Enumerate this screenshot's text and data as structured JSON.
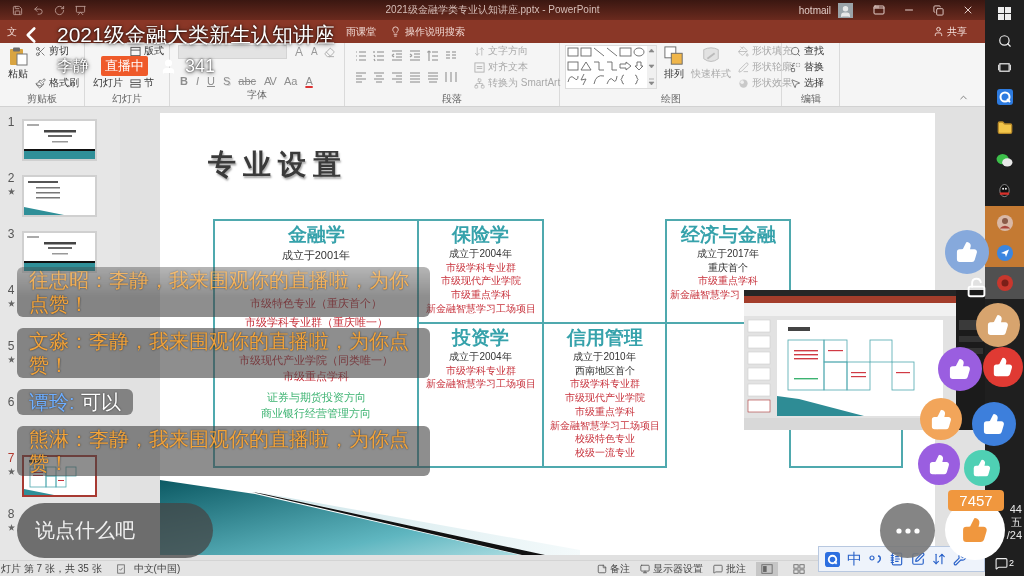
{
  "stream": {
    "title": "2021级金融大类新生认知讲座",
    "host": "李静",
    "status": "直播中",
    "viewers": "341",
    "chat": [
      {
        "kind": "like",
        "user": "往忠昭：",
        "text": "李静，我来围观你的直播啦，为你点赞！"
      },
      {
        "kind": "like",
        "user": "文淼：",
        "text": "李静，我来围观你的直播啦，为你点赞！"
      },
      {
        "kind": "chat",
        "user": "谭玲:",
        "text": "可以"
      },
      {
        "kind": "like",
        "user": "熊淋：",
        "text": "李静，我来围观你的直播啦，为你点赞！"
      }
    ],
    "input": {
      "placeholder": "说点什么吧"
    },
    "like_count": "7457",
    "floating_likes": [
      {
        "color": "#86a9dc"
      },
      {
        "color": "#d7a46e"
      },
      {
        "color": "#9a5ee0"
      },
      {
        "color": "#e03a33"
      },
      {
        "color": "#f2a55a"
      },
      {
        "color": "#3d7fdc"
      },
      {
        "color": "#9a5ee0"
      },
      {
        "color": "#4fd0b4"
      }
    ]
  },
  "powerpoint": {
    "window_title": "2021级金融学类专业认知讲座.pptx - PowerPoint",
    "account": "hotmail",
    "tabs": [
      {
        "label": "文",
        "selected": false
      },
      {
        "label": "雨课堂",
        "selected": false
      }
    ],
    "search": "操作说明搜索",
    "share": "共享",
    "ribbon": [
      {
        "kind": "clipboard",
        "label": "剪贴板",
        "big": [
          {
            "label": "粘贴",
            "disabled": false
          }
        ],
        "small": [
          {
            "label": "剪切",
            "disabled": false
          },
          {
            "label": "格式刷",
            "disabled": false
          }
        ]
      },
      {
        "kind": "slides",
        "label": "幻灯片",
        "big": [
          {
            "label": "幻灯片",
            "disabled": false
          }
        ],
        "small": [
          {
            "label": "版式",
            "disabled": false
          },
          {
            "label": "节",
            "disabled": false
          }
        ]
      },
      {
        "kind": "font",
        "label": "字体",
        "size_buttons": [
          "A",
          "A"
        ],
        "buttons": [
          "B",
          "I",
          "U",
          "S",
          "abc",
          "AV",
          "Aa",
          "A"
        ]
      },
      {
        "kind": "paragraph",
        "label": "段落",
        "small": [
          {
            "label": "文字方向",
            "disabled": true
          },
          {
            "label": "对齐文本",
            "disabled": true
          },
          {
            "label": "转换为 SmartArt",
            "disabled": true
          }
        ]
      },
      {
        "kind": "drawing",
        "label": "绘图",
        "big": [
          {
            "label": "排列",
            "disabled": false
          },
          {
            "label": "快速样式",
            "disabled": true
          }
        ],
        "small": [
          {
            "label": "形状填充",
            "disabled": true
          },
          {
            "label": "形状轮廓",
            "disabled": true
          },
          {
            "label": "形状效果",
            "disabled": true
          }
        ]
      },
      {
        "kind": "editing",
        "label": "编辑",
        "small": [
          {
            "label": "查找",
            "disabled": false
          },
          {
            "label": "替换",
            "disabled": false
          },
          {
            "label": "选择",
            "disabled": false
          }
        ]
      }
    ],
    "slides": [
      {
        "number": "1",
        "animated": false,
        "selected": false,
        "preview": {
          "kind": "title"
        }
      },
      {
        "number": "2",
        "animated": true,
        "selected": false,
        "preview": {
          "kind": "list"
        }
      },
      {
        "number": "3",
        "animated": false,
        "selected": false,
        "preview": {
          "kind": "title"
        }
      },
      {
        "number": "4",
        "animated": true,
        "selected": false
      },
      {
        "number": "5",
        "animated": true,
        "selected": false
      },
      {
        "number": "6",
        "animated": false,
        "selected": false
      },
      {
        "number": "7",
        "animated": true,
        "selected": true,
        "preview": {
          "kind": "table"
        }
      },
      {
        "number": "8",
        "animated": true,
        "selected": false
      }
    ],
    "slide": {
      "title": "专业设置",
      "boxes": [
        {
          "title": "金融学",
          "lines": [
            {
              "kind": "fact",
              "text": "成立于2001年"
            },
            {
              "kind": "honor",
              "text": "市级特色专业（重庆首个）"
            },
            {
              "kind": "honor",
              "text": "市级学科专业群（重庆唯一）"
            },
            {
              "kind": "honor",
              "text": "市级现代产业学院（同类唯一）"
            },
            {
              "kind": "honor",
              "text": "市级重点学科"
            },
            {
              "kind": "track",
              "text": "证券与期货投资方向"
            },
            {
              "kind": "track",
              "text": "商业银行经营管理方向"
            }
          ]
        },
        {
          "title": "保险学",
          "lines": [
            {
              "kind": "fact",
              "text": "成立于2004年"
            },
            {
              "kind": "honor",
              "text": "市级学科专业群"
            },
            {
              "kind": "honor",
              "text": "市级现代产业学院"
            },
            {
              "kind": "honor",
              "text": "市级重点学科"
            },
            {
              "kind": "honor",
              "text": "新金融智慧学习工场项目"
            }
          ]
        },
        {
          "title": "投资学",
          "lines": [
            {
              "kind": "fact",
              "text": "成立于2004年"
            },
            {
              "kind": "honor",
              "text": "市级学科专业群"
            },
            {
              "kind": "honor",
              "text": "新金融智慧学习工场项目"
            }
          ]
        },
        {
          "title": "信用管理",
          "lines": [
            {
              "kind": "fact",
              "text": "成立于2010年"
            },
            {
              "kind": "fact",
              "text": "西南地区首个"
            },
            {
              "kind": "honor",
              "text": "市级学科专业群"
            },
            {
              "kind": "honor",
              "text": "市级现代产业学院"
            },
            {
              "kind": "honor",
              "text": "市级重点学科"
            },
            {
              "kind": "honor",
              "text": "新金融智慧学习工场项目"
            },
            {
              "kind": "honor",
              "text": "校级特色专业"
            },
            {
              "kind": "honor",
              "text": "校级一流专业"
            }
          ]
        },
        {
          "title": "经济与金融",
          "lines": [
            {
              "kind": "fact",
              "text": "成立于2017年"
            },
            {
              "kind": "fact",
              "text": "重庆首个"
            },
            {
              "kind": "honor",
              "text": "市级重点学科"
            },
            {
              "kind": "honor",
              "text": "新金融智慧学习"
            }
          ]
        }
      ]
    },
    "status_bar": {
      "position": "灯片 第 7 张，共 35 张",
      "language": "中文(中国)",
      "notes": "备注",
      "display": "显示器设置",
      "comments": "批注",
      "views": [
        {
          "selected": true
        },
        {
          "selected": false
        }
      ]
    }
  },
  "taskbar": {
    "clock": [
      "44",
      "五",
      "/24"
    ],
    "notifications": "2"
  },
  "ime": {
    "mode": "中"
  }
}
